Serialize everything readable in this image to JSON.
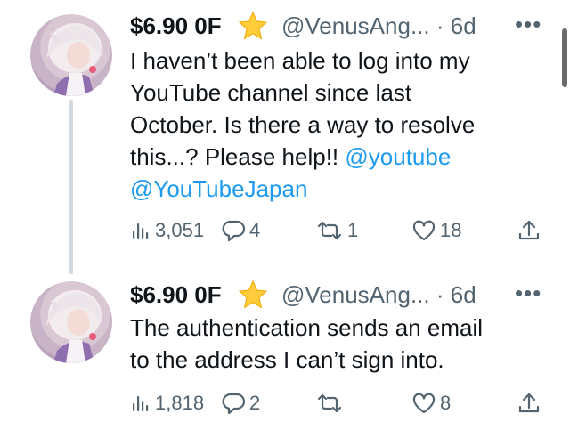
{
  "tweets": [
    {
      "display_name": "$6.90 0F",
      "handle": "@VenusAng...",
      "sep": "·",
      "time": "6d",
      "more": "•••",
      "text_lines": [
        "I haven’t been able to log into my",
        "YouTube channel since last",
        "October. Is there a way to resolve",
        "this...? Please help!! "
      ],
      "mention1": "@youtube",
      "mention2": "@YouTubeJapan",
      "views": "3,051",
      "replies": "4",
      "retweets": "1",
      "likes": "18"
    },
    {
      "display_name": "$6.90 0F",
      "handle": "@VenusAng...",
      "sep": "·",
      "time": "6d",
      "more": "•••",
      "text_lines": [
        "The authentication sends an email",
        "to the address I can’t sign into."
      ],
      "views": "1,818",
      "replies": "2",
      "retweets": "",
      "likes": "8"
    }
  ],
  "colors": {
    "accent": "#1d9bf0",
    "text": "#0f1419",
    "muted": "#536471",
    "line": "#cfd9de"
  },
  "icons": [
    "star-emoji-icon",
    "views-icon",
    "reply-icon",
    "retweet-icon",
    "like-icon",
    "share-icon",
    "more-icon"
  ]
}
